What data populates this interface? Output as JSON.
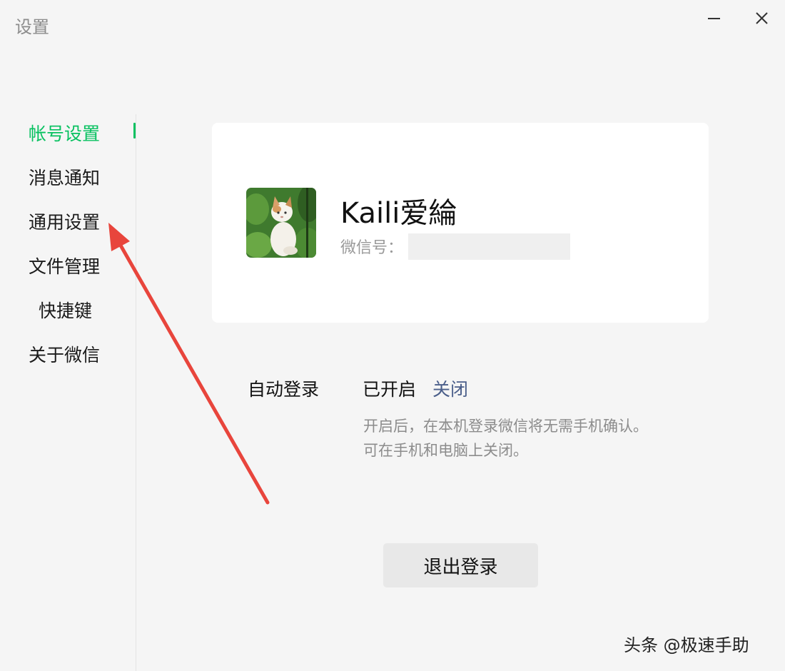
{
  "window": {
    "title": "设置",
    "minimize_icon": "minimize-icon",
    "close_icon": "close-icon"
  },
  "sidebar": {
    "active_color": "#07c160",
    "items": [
      {
        "label": "帐号设置",
        "active": true
      },
      {
        "label": "消息通知",
        "active": false
      },
      {
        "label": "通用设置",
        "active": false
      },
      {
        "label": "文件管理",
        "active": false
      },
      {
        "label": "快捷键",
        "active": false
      },
      {
        "label": "关于微信",
        "active": false
      }
    ]
  },
  "profile": {
    "nickname": "Kaili爱綸",
    "wechat_id_label": "微信号："
  },
  "auto_login": {
    "label": "自动登录",
    "status": "已开启",
    "toggle_action": "关闭",
    "description_line1": "开启后，在本机登录微信将无需手机确认。",
    "description_line2": "可在手机和电脑上关闭。"
  },
  "logout": {
    "label": "退出登录"
  },
  "overlay": {
    "arrow_color": "#e8453c",
    "watermark": "头条 @极速手助"
  }
}
